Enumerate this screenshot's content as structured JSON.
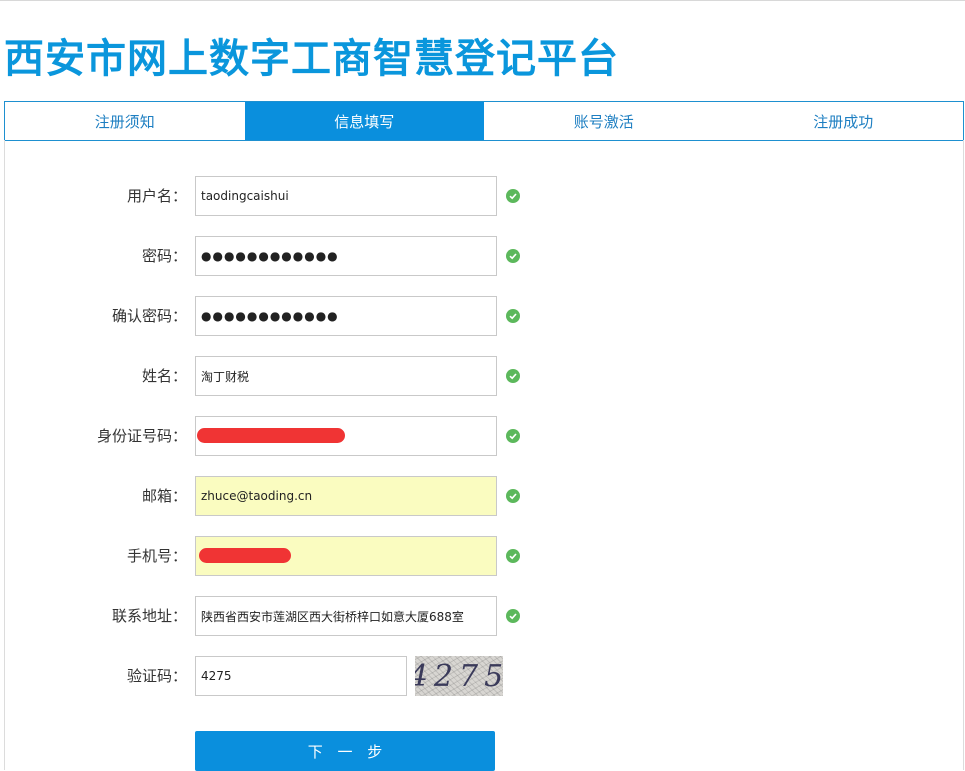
{
  "header": {
    "title": "西安市网上数字工商智慧登记平台"
  },
  "tabs": [
    {
      "label": "注册须知",
      "active": false
    },
    {
      "label": "信息填写",
      "active": true
    },
    {
      "label": "账号激活",
      "active": false
    },
    {
      "label": "注册成功",
      "active": false
    }
  ],
  "form": {
    "username": {
      "label": "用户名：",
      "value": "taodingcaishui"
    },
    "password": {
      "label": "密码：",
      "value": "●●●●●●●●●●●●"
    },
    "confirm_password": {
      "label": "确认密码：",
      "value": "●●●●●●●●●●●●"
    },
    "name": {
      "label": "姓名：",
      "value": "淘丁财税"
    },
    "id_number": {
      "label": "身份证号码：",
      "value": ""
    },
    "email": {
      "label": "邮箱：",
      "value": "zhuce@taoding.cn"
    },
    "phone": {
      "label": "手机号：",
      "value": ""
    },
    "address": {
      "label": "联系地址：",
      "value": "陕西省西安市莲湖区西大街桥梓口如意大厦688室"
    },
    "captcha": {
      "label": "验证码：",
      "value": "4275",
      "image_text": "4275"
    }
  },
  "buttons": {
    "next_label": "下 一 步"
  },
  "colors": {
    "brand": "#0a96dc",
    "tab_active": "#0a8fdd",
    "check": "#5cb85c",
    "autofill": "#fafcc0",
    "redaction": "#f03434"
  },
  "icons": {
    "field_valid": "check-circle-icon"
  }
}
